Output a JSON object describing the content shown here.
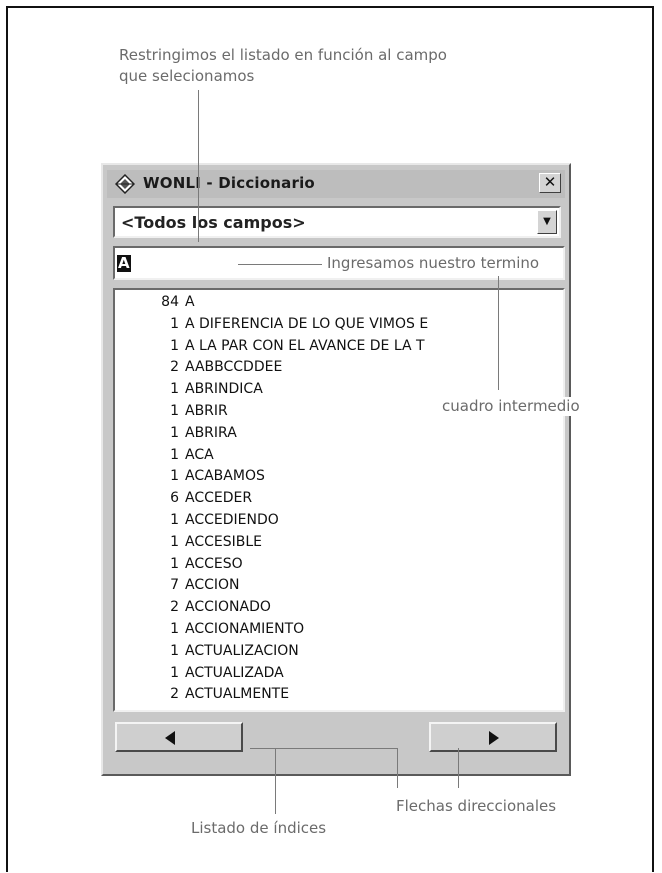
{
  "annotations": {
    "top_line1": "Restringimos el listado en función al campo",
    "top_line2": "que selecionamos",
    "term": "Ingresamos nuestro termino",
    "middle": "cuadro intermedio",
    "arrows": "Flechas direccionales",
    "index": "Listado de índices"
  },
  "window": {
    "title": "WONLI - Diccionario",
    "close_symbol": "✕",
    "app_icon": "wonli-app-icon"
  },
  "field_select": {
    "selected": "<Todos los campos>",
    "arrow_symbol": "▼"
  },
  "term_input": {
    "value": "A"
  },
  "list": {
    "rows": [
      {
        "count": "84",
        "word": "A"
      },
      {
        "count": "1",
        "word": "A DIFERENCIA DE LO QUE VIMOS E"
      },
      {
        "count": "1",
        "word": "A LA PAR CON EL AVANCE DE LA T"
      },
      {
        "count": "2",
        "word": "AABBCCDDEE"
      },
      {
        "count": "1",
        "word": "ABRINDICA"
      },
      {
        "count": "1",
        "word": "ABRIR"
      },
      {
        "count": "1",
        "word": "ABRIRA"
      },
      {
        "count": "1",
        "word": "ACA"
      },
      {
        "count": "1",
        "word": "ACABAMOS"
      },
      {
        "count": "6",
        "word": "ACCEDER"
      },
      {
        "count": "1",
        "word": "ACCEDIENDO"
      },
      {
        "count": "1",
        "word": "ACCESIBLE"
      },
      {
        "count": "1",
        "word": "ACCESO"
      },
      {
        "count": "7",
        "word": "ACCION"
      },
      {
        "count": "2",
        "word": "ACCIONADO"
      },
      {
        "count": "1",
        "word": "ACCIONAMIENTO"
      },
      {
        "count": "1",
        "word": "ACTUALIZACION"
      },
      {
        "count": "1",
        "word": "ACTUALIZADA"
      },
      {
        "count": "2",
        "word": "ACTUALMENTE"
      }
    ]
  },
  "navigation": {
    "prev_icon": "left-arrow-icon",
    "next_icon": "right-arrow-icon"
  }
}
